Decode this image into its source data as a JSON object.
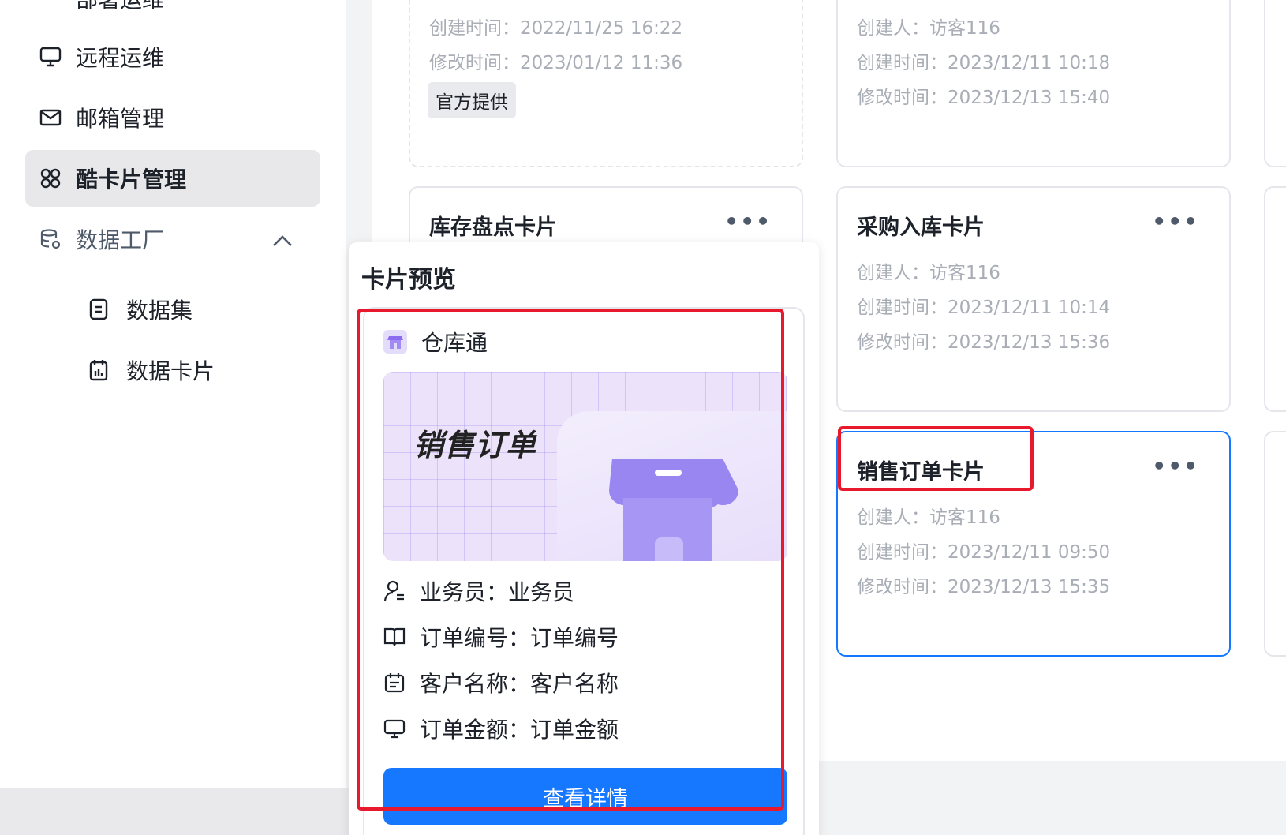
{
  "sidebar": {
    "partial_item": "部署运维",
    "items": [
      {
        "label": "远程运维",
        "icon": "monitor-icon"
      },
      {
        "label": "邮箱管理",
        "icon": "mail-icon"
      },
      {
        "label": "酷卡片管理",
        "icon": "grid-icon",
        "active": true
      },
      {
        "label": "数据工厂",
        "icon": "database-settings-icon",
        "expanded": true
      }
    ],
    "sub_items": [
      {
        "label": "数据集",
        "icon": "dataset-icon"
      },
      {
        "label": "数据卡片",
        "icon": "chart-card-icon"
      }
    ]
  },
  "cards": {
    "top_left": {
      "created_time": "创建时间：2022/11/25 16:22",
      "modified_time": "修改时间：2023/01/12 11:36",
      "tag": "官方提供"
    },
    "top_right": {
      "creator": "创建人：访客116",
      "created_time": "创建时间：2023/12/11 10:18",
      "modified_time": "修改时间：2023/12/13 15:40"
    },
    "inventory": {
      "title": "库存盘点卡片",
      "more": "•••"
    },
    "purchase": {
      "title": "采购入库卡片",
      "more": "•••",
      "creator": "创建人：访客116",
      "created_time": "创建时间：2023/12/11 10:14",
      "modified_time": "修改时间：2023/12/13 15:36"
    },
    "sales": {
      "title": "销售订单卡片",
      "more": "•••",
      "creator": "创建人：访客116",
      "created_time": "创建时间：2023/12/11 09:50",
      "modified_time": "修改时间：2023/12/13 15:35"
    }
  },
  "preview": {
    "title": "卡片预览",
    "app_name": "仓库通",
    "banner_title": "销售订单",
    "fields": [
      {
        "text": "业务员：业务员",
        "icon": "user-icon"
      },
      {
        "text": "订单编号：订单编号",
        "icon": "book-icon"
      },
      {
        "text": "客户名称：客户名称",
        "icon": "calendar-icon"
      },
      {
        "text": "订单金额：订单金额",
        "icon": "monitor-icon"
      }
    ],
    "button": "查看详情"
  },
  "colors": {
    "primary": "#1677ff",
    "highlight": "#e8192c",
    "muted_text": "#a9adb6"
  }
}
